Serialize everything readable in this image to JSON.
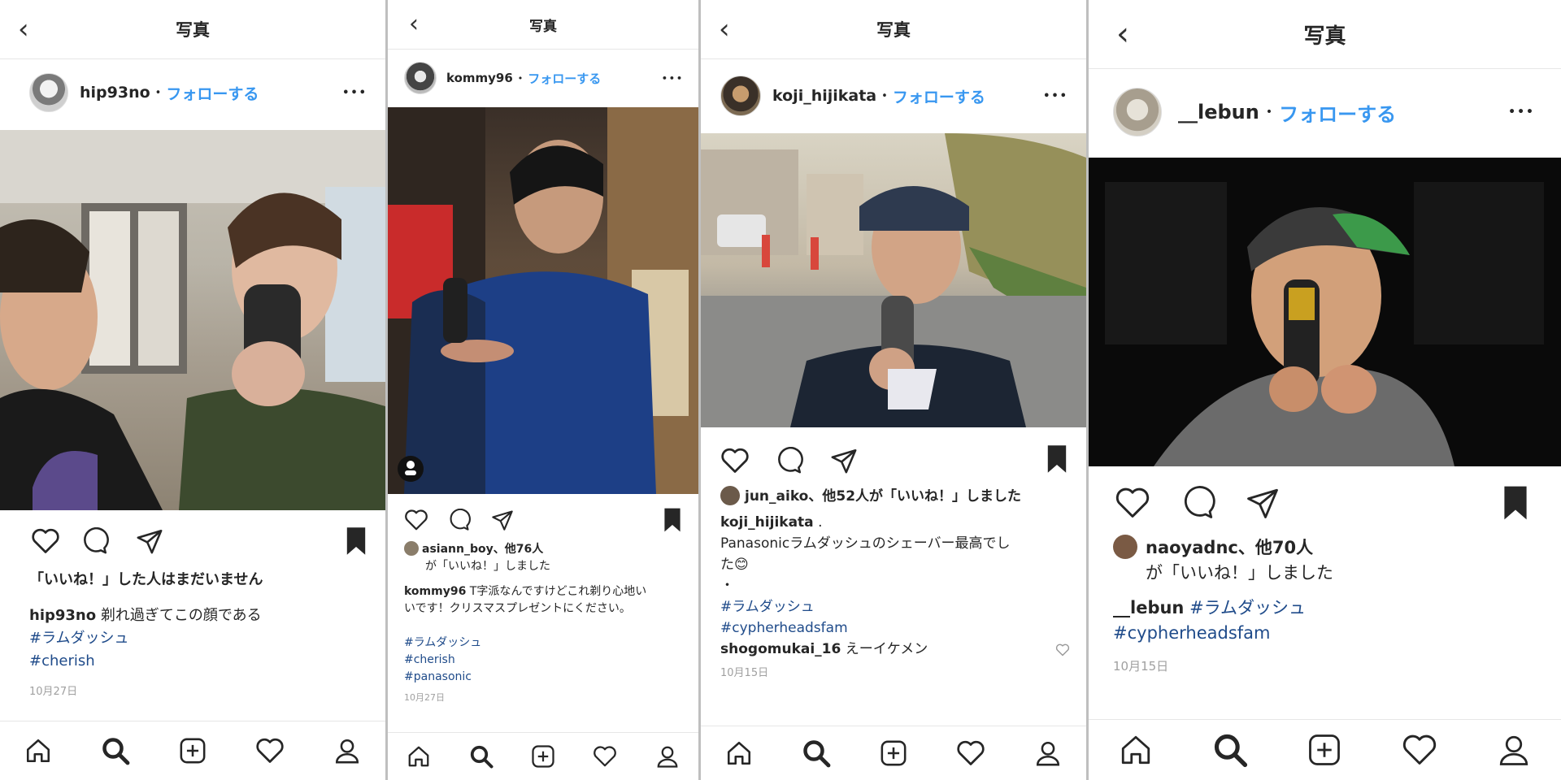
{
  "colors": {
    "accent": "#3897f0",
    "hashtag": "#1f4b8a",
    "muted": "#a0a0a0"
  },
  "panels": [
    {
      "nav_title": "写真",
      "username": "hip93no",
      "separator": "•",
      "follow": "フォローする",
      "more": "•••",
      "likes_line1": "「いいね！」した人はまだいません",
      "caption_user": "hip93no",
      "caption_text": "剃れ過ぎてこの顔である",
      "hashtags": [
        "#ラムダッシュ",
        "#cherish"
      ],
      "date": "10月27日"
    },
    {
      "nav_title": "写真",
      "username": "kommy96",
      "separator": "•",
      "follow": "フォローする",
      "more": "•••",
      "likes_user": "asiann_boy",
      "likes_rest": "、他76人",
      "likes_line2": "が「いいね！」しました",
      "caption_user": "kommy96",
      "caption_line1": "T字派なんですけどこれ剃り心地い",
      "caption_line2": "いです！クリスマスプレゼントにください。",
      "hashtags": [
        "#ラムダッシュ",
        "#cherish",
        "#panasonic"
      ],
      "date": "10月27日"
    },
    {
      "nav_title": "写真",
      "username": "koji_hijikata",
      "separator": "•",
      "follow": "フォローする",
      "more": "•••",
      "likes_user": "jun_aiko",
      "likes_rest": "、他52人が「いいね！」しました",
      "caption_user": "koji_hijikata",
      "caption_user_suffix": ".",
      "caption_line1": "Panasonicラムダッシュのシェーバー最高でし",
      "caption_line2": "た😊",
      "caption_line3": "・",
      "hashtags": [
        "#ラムダッシュ",
        "#cypherheadsfam"
      ],
      "comment_user": "shogomukai_16",
      "comment_text": "えーイケメン",
      "date": "10月15日"
    },
    {
      "nav_title": "写真",
      "username": "__lebun",
      "separator": "•",
      "follow": "フォローする",
      "more": "•••",
      "likes_user": "naoyadnc",
      "likes_rest": "、他70人",
      "likes_line2": "が「いいね！」しました",
      "caption_user": "__lebun",
      "hashtags": [
        "#ラムダッシュ",
        "#cypherheadsfam"
      ],
      "date": "10月15日"
    }
  ]
}
